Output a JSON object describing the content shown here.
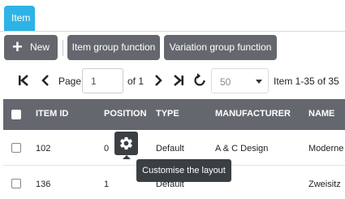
{
  "tabs": [
    {
      "label": "Item"
    }
  ],
  "toolbar": {
    "new_label": "New",
    "item_group_label": "Item group function",
    "variation_group_label": "Variation group function"
  },
  "pager": {
    "page_label": "Page",
    "page_value": "1",
    "of_label": "of 1",
    "rows_per_page": "50",
    "range_text": "Item 1-35 of 35"
  },
  "table": {
    "columns": [
      "ITEM ID",
      "POSITION",
      "TYPE",
      "MANUFACTURER",
      "NAME"
    ],
    "rows": [
      {
        "item_id": "102",
        "position": "0",
        "type": "Default",
        "manufacturer": "A & C Design",
        "name": "Moderne"
      },
      {
        "item_id": "136",
        "position": "1",
        "type": "Default",
        "manufacturer": "",
        "name": "Zweisitz"
      }
    ]
  },
  "tooltip": {
    "text": "Customise the layout"
  },
  "colors": {
    "accent": "#2eb3e6",
    "button": "#64686e",
    "header": "#64686e",
    "tooltip": "#3a3f44"
  }
}
